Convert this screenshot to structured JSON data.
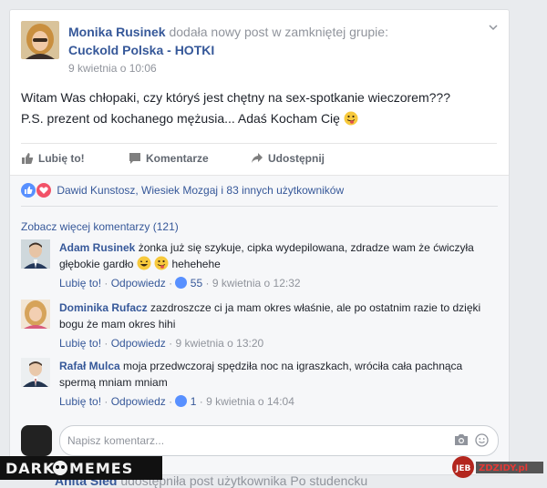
{
  "post": {
    "author": "Monika Rusinek",
    "action": "dodała nowy post w zamkniętej grupie:",
    "group": "Cuckold Polska - HOTKI",
    "time": "9 kwietnia o 10:06",
    "text_line1": "Witam Was chłopaki, czy któryś jest chętny na sex-spotkanie wieczorem???",
    "text_line2": "P.S. prezent od kochanego mężusia... Adaś Kocham Cię",
    "actions": {
      "like": "Lubię to!",
      "comment": "Komentarze",
      "share": "Udostępnij"
    }
  },
  "reactions": {
    "text": "Dawid Kunstosz, Wiesiek Mozgaj i 83 innych użytkowników"
  },
  "comments_section": {
    "more": "Zobacz więcej komentarzy (121)",
    "items": [
      {
        "name": "Adam Rusinek",
        "text": "żonka już się szykuje, cipka wydepilowana, zdradze wam że ćwiczyła głębokie gardło",
        "text_tail": "hehehehe",
        "like": "Lubię to!",
        "reply": "Odpowiedz",
        "likes": "55",
        "time": "9 kwietnia o 12:32"
      },
      {
        "name": "Dominika Rufacz",
        "text": "zazdroszcze ci ja mam okres właśnie, ale po ostatnim razie to dzięki bogu że mam okres hihi",
        "like": "Lubię to!",
        "reply": "Odpowiedz",
        "time": "9 kwietnia o 13:20"
      },
      {
        "name": "Rafał Mulca",
        "text": "moja przedwczoraj spędziła noc na igraszkach, wróciła cała pachnąca spermą mniam mniam",
        "like": "Lubię to!",
        "reply": "Odpowiedz",
        "likes": "1",
        "time": "9 kwietnia o 14:04"
      }
    ],
    "composer_placeholder": "Napisz komentarz..."
  },
  "footer": {
    "watermark": "DARKMEMES",
    "next_name": "Anita Sled",
    "next_action": "udostępniła post użytkownika Po studencku"
  },
  "colors": {
    "link": "#365899",
    "meta": "#90949c",
    "like_blue": "#5890ff",
    "love_red": "#f25268"
  }
}
